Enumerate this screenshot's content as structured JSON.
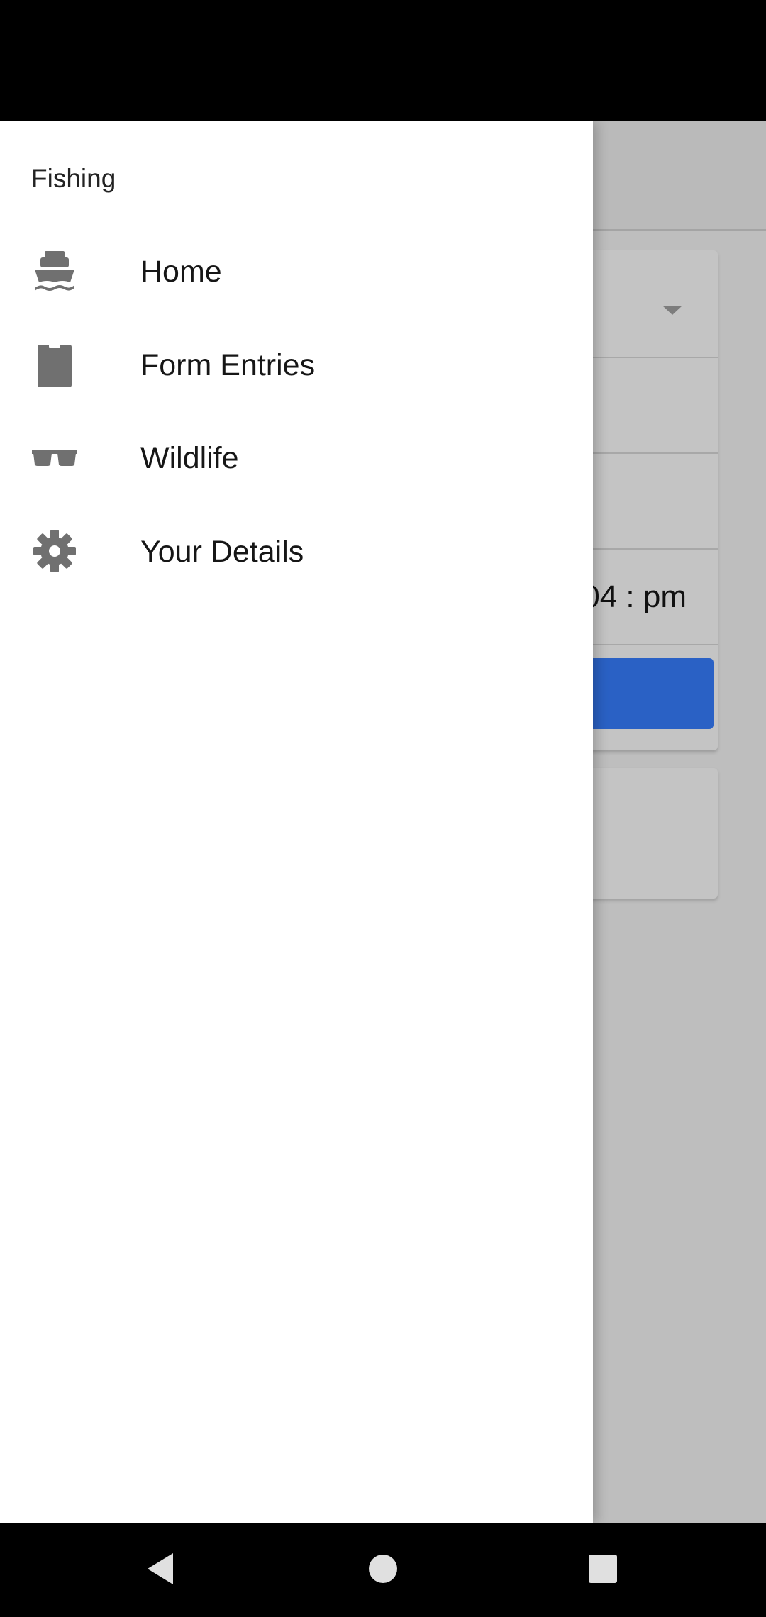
{
  "drawer": {
    "title": "Fishing",
    "items": [
      {
        "label": "Home",
        "icon": "boat-icon"
      },
      {
        "label": "Form Entries",
        "icon": "clipboard-icon"
      },
      {
        "label": "Wildlife",
        "icon": "sunglasses-icon"
      },
      {
        "label": "Your Details",
        "icon": "gear-icon"
      }
    ]
  },
  "background": {
    "time_value": "04 : pm"
  },
  "colors": {
    "icon": "#707070",
    "primary_button": "#2a61c5",
    "drawer_bg": "#ffffff",
    "scrim": "#bebebe"
  },
  "system_nav": {
    "back": "back-icon",
    "home": "home-icon",
    "recents": "recents-icon"
  }
}
